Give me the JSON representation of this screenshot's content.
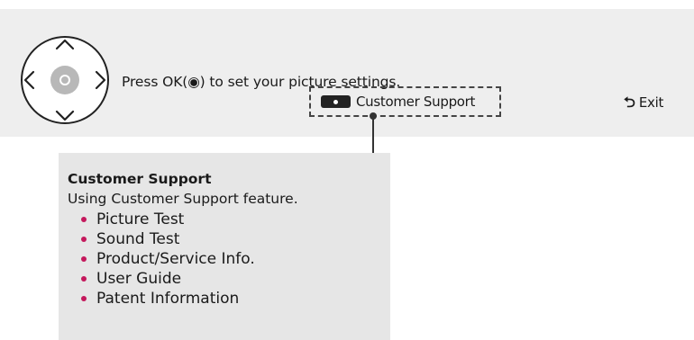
{
  "osd": {
    "instruction": "Press OK(◉) to set your picture settings.",
    "customer_support_button": {
      "key_color": "red",
      "label": "Customer Support"
    },
    "exit_button": {
      "icon": "back-arrow-icon",
      "label": "Exit"
    },
    "nav_pad": {
      "icons": [
        "up-arrow-icon",
        "left-arrow-icon",
        "ok-center-icon",
        "right-arrow-icon",
        "down-arrow-icon"
      ]
    }
  },
  "info_panel": {
    "title": "Customer Support",
    "description": "Using Customer Support feature.",
    "items": [
      {
        "label": "Picture Test"
      },
      {
        "label": "Sound Test"
      },
      {
        "label": "Product/Service Info."
      },
      {
        "label": "User Guide"
      },
      {
        "label": "Patent Information"
      }
    ]
  },
  "colors": {
    "osd_background": "#eeeeee",
    "panel_background": "#e6e6e6",
    "bullet": "#c4185c"
  }
}
